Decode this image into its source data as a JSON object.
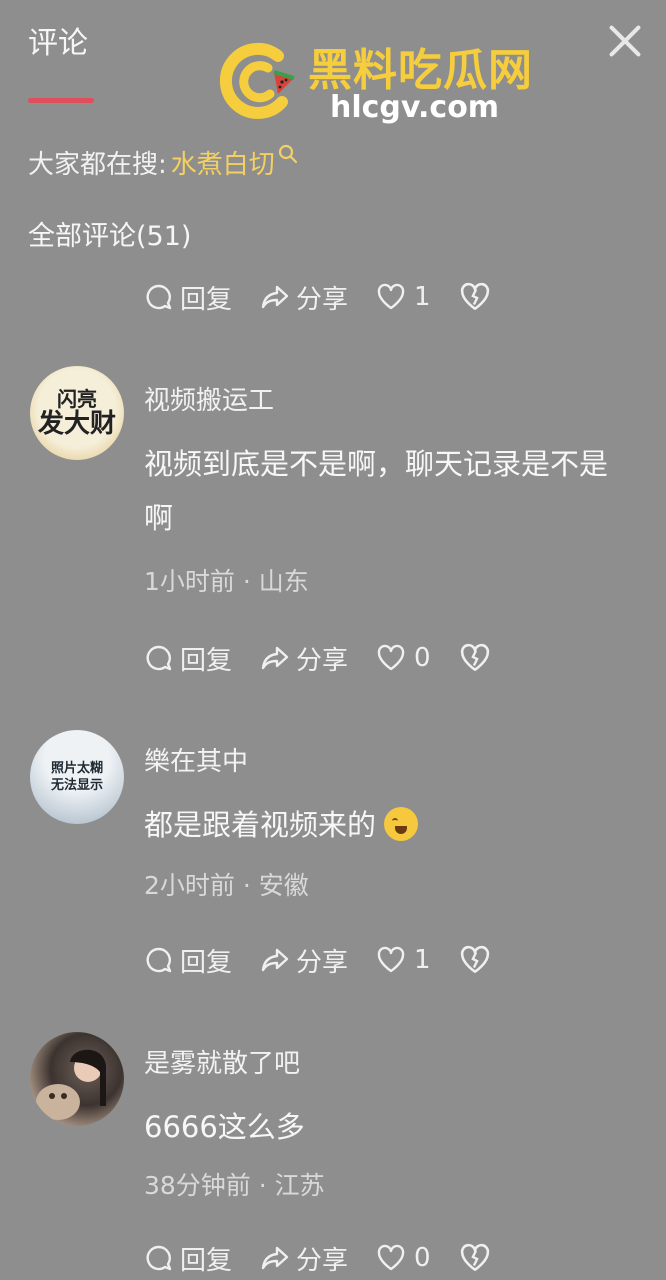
{
  "header": {
    "tab_label": "评论",
    "close_icon": "close-icon"
  },
  "watermark": {
    "name": "黑料吃瓜网",
    "url": "hlcgv.com",
    "brand_color": "#f6cd3d"
  },
  "search": {
    "prefix": "大家都在搜:",
    "term": "水煮白切",
    "term_color": "#f4d062"
  },
  "comments_header": {
    "label": "全部评论(51)"
  },
  "action_labels": {
    "reply": "回复",
    "share": "分享"
  },
  "top_actions": {
    "likes": "1"
  },
  "comments": [
    {
      "username": "视频搬运工",
      "avatar_line1": "闪亮",
      "avatar_line2": "发大财",
      "text_line1": "视频到底是不是啊，聊天记录是不是",
      "text_line2": "啊",
      "time": "1小时前",
      "location": "山东",
      "likes": "0"
    },
    {
      "username": "樂在其中",
      "avatar_line1": "照片太糊",
      "avatar_line2": "无法显示",
      "text_line1": "都是跟着视频来的",
      "emoji": "crying-laughing-emoji",
      "time": "2小时前",
      "location": "安徽",
      "likes": "1"
    },
    {
      "username": "是雾就散了吧",
      "text_line1": "6666这么多",
      "time": "38分钟前",
      "location": "江苏",
      "likes": "0"
    }
  ],
  "meta_separator": "·"
}
